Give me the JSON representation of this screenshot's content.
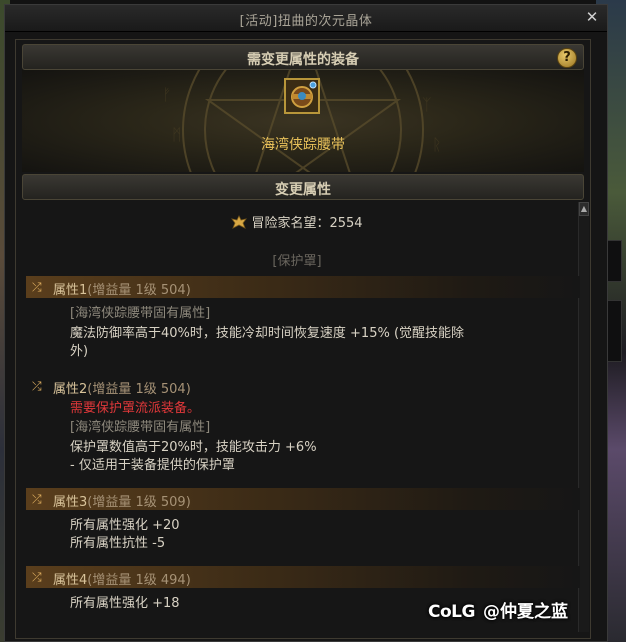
{
  "window": {
    "title": "[活动]扭曲的次元晶体",
    "close_icon": "✕"
  },
  "equipment_section": {
    "header": "需变更属性的装备",
    "help_icon": "?",
    "item_name": "海湾侠踪腰带"
  },
  "change_section": {
    "header": "变更属性"
  },
  "fame": {
    "label": "冒险家名望：2554"
  },
  "category": "[保护罩]",
  "attributes": [
    {
      "title": "属性1",
      "sub": "(增益量 1级 504)",
      "lines": [
        {
          "text": "[海湾侠踪腰带固有属性]",
          "type": "fixed"
        },
        {
          "text": "魔法防御率高于40%时，技能冷却时间恢复速度 +15% (觉醒技能除",
          "type": "normal"
        },
        {
          "text": "外)",
          "type": "normal"
        }
      ]
    },
    {
      "title": "属性2",
      "sub": "(增益量 1级 504)",
      "lines": [
        {
          "text": "需要保护罩流派装备。",
          "type": "warn"
        },
        {
          "text": "[海湾侠踪腰带固有属性]",
          "type": "fixed"
        },
        {
          "text": "保护罩数值高于20%时，技能攻击力 +6%",
          "type": "normal"
        },
        {
          "text": "- 仅适用于装备提供的保护罩",
          "type": "normal"
        }
      ]
    },
    {
      "title": "属性3",
      "sub": "(增益量 1级 509)",
      "lines": [
        {
          "text": "所有属性强化 +20",
          "type": "normal"
        },
        {
          "text": "所有属性抗性 -5",
          "type": "normal"
        }
      ]
    },
    {
      "title": "属性4",
      "sub": "(增益量 1级 494)",
      "lines": [
        {
          "text": "所有属性强化 +18",
          "type": "normal"
        }
      ]
    }
  ],
  "watermark": {
    "logo": "CoLG",
    "text": "@仲夏之蓝"
  },
  "colors": {
    "accent_gold": "#e8c15a",
    "warn_red": "#e0383a",
    "fixed_gray": "#8d887c"
  },
  "icons": {
    "attribute": "shuffle-icon",
    "fame": "fame-crest-icon",
    "help": "help-icon",
    "close": "close-icon"
  }
}
